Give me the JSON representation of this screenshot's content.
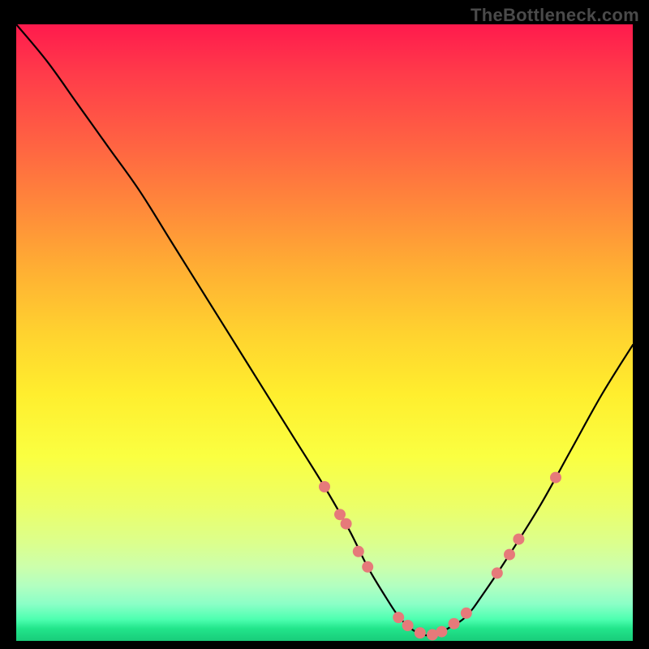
{
  "watermark": "TheBottleneck.com",
  "chart_data": {
    "type": "line",
    "title": "",
    "xlabel": "",
    "ylabel": "",
    "xlim": [
      0,
      100
    ],
    "ylim": [
      0,
      100
    ],
    "grid": false,
    "legend": false,
    "series": [
      {
        "name": "curve",
        "color": "#000000",
        "x": [
          0,
          5,
          10,
          15,
          20,
          25,
          30,
          35,
          40,
          45,
          50,
          54,
          57,
          60,
          62,
          64,
          66,
          68,
          70,
          73,
          76,
          80,
          85,
          90,
          95,
          100
        ],
        "y": [
          100,
          94,
          87,
          80,
          73,
          65,
          57,
          49,
          41,
          33,
          25,
          18,
          12,
          7,
          4,
          2,
          1,
          1,
          2,
          4,
          8,
          14,
          22,
          31,
          40,
          48
        ]
      }
    ],
    "markers": [
      {
        "x": 50.0,
        "y": 25.0
      },
      {
        "x": 52.5,
        "y": 20.5
      },
      {
        "x": 53.5,
        "y": 19.0
      },
      {
        "x": 55.5,
        "y": 14.5
      },
      {
        "x": 57.0,
        "y": 12.0
      },
      {
        "x": 62.0,
        "y": 3.8
      },
      {
        "x": 63.5,
        "y": 2.5
      },
      {
        "x": 65.5,
        "y": 1.3
      },
      {
        "x": 67.5,
        "y": 1.0
      },
      {
        "x": 69.0,
        "y": 1.5
      },
      {
        "x": 71.0,
        "y": 2.8
      },
      {
        "x": 73.0,
        "y": 4.5
      },
      {
        "x": 78.0,
        "y": 11.0
      },
      {
        "x": 80.0,
        "y": 14.0
      },
      {
        "x": 81.5,
        "y": 16.5
      },
      {
        "x": 87.5,
        "y": 26.5
      }
    ],
    "marker_style": {
      "color": "#e67a7a",
      "radius_px": 7
    },
    "gradient_stops": [
      {
        "pos": 0.0,
        "color": "#ff1a4d"
      },
      {
        "pos": 0.5,
        "color": "#ffd22f"
      },
      {
        "pos": 0.78,
        "color": "#ecff67"
      },
      {
        "pos": 1.0,
        "color": "#18cc7a"
      }
    ]
  }
}
